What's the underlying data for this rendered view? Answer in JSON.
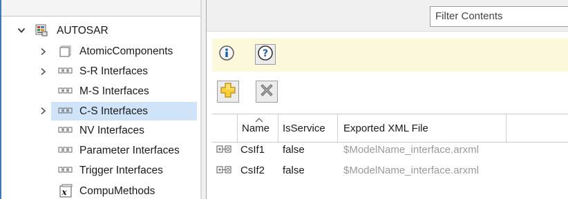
{
  "tree": {
    "root": {
      "label": "AUTOSAR",
      "expanded": true,
      "icon": "autosar-package-icon"
    },
    "items": [
      {
        "label": "AtomicComponents",
        "icon": "component-icon",
        "expandable": true,
        "selected": false
      },
      {
        "label": "S-R Interfaces",
        "icon": "interface-icon",
        "expandable": true,
        "selected": false
      },
      {
        "label": "M-S Interfaces",
        "icon": "interface-icon",
        "expandable": false,
        "selected": false
      },
      {
        "label": "C-S Interfaces",
        "icon": "interface-icon",
        "expandable": true,
        "selected": true
      },
      {
        "label": "NV Interfaces",
        "icon": "interface-icon",
        "expandable": false,
        "selected": false
      },
      {
        "label": "Parameter Interfaces",
        "icon": "interface-icon",
        "expandable": false,
        "selected": false
      },
      {
        "label": "Trigger Interfaces",
        "icon": "interface-icon",
        "expandable": false,
        "selected": false
      },
      {
        "label": "CompuMethods",
        "icon": "compu-method-icon",
        "expandable": false,
        "selected": false
      }
    ]
  },
  "filter": {
    "placeholder": "Filter Contents",
    "value": ""
  },
  "infobar": {
    "info_icon": "info-icon",
    "help_icon": "help-icon"
  },
  "toolbar": {
    "add_icon": "add-icon",
    "delete_icon": "delete-icon"
  },
  "table": {
    "columns": [
      "Name",
      "IsService",
      "Exported XML File"
    ],
    "sort_column": "Name",
    "rows": [
      {
        "icon": "cs-interface-icon",
        "name": "CsIf1",
        "is_service": "false",
        "xml_file": "$ModelName_interface.arxml"
      },
      {
        "icon": "cs-interface-icon",
        "name": "CsIf2",
        "is_service": "false",
        "xml_file": "$ModelName_interface.arxml"
      }
    ]
  },
  "colors": {
    "selection": "#cfe4f9",
    "info_band": "#fcf8dc",
    "accent": "#3d7ab8",
    "muted_text": "#9a9a9a"
  }
}
